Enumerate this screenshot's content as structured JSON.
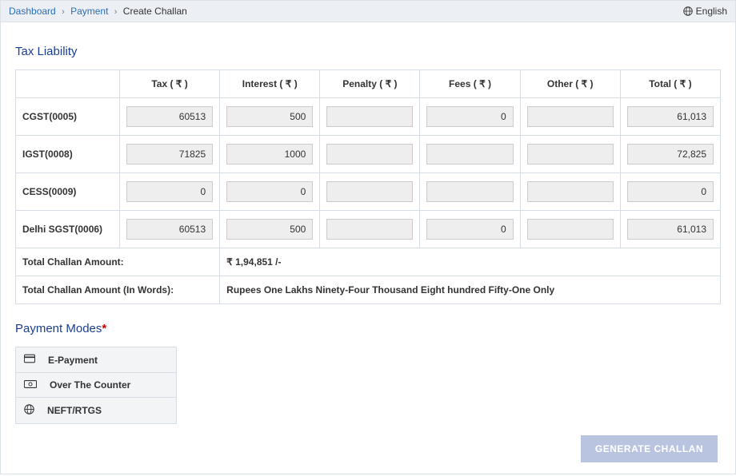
{
  "breadcrumb": {
    "dashboard": "Dashboard",
    "payment": "Payment",
    "current": "Create Challan",
    "sep": "›"
  },
  "language_label": "English",
  "section_liability": "Tax Liability",
  "rupee": "₹",
  "columns": {
    "tax": "Tax ( ₹ )",
    "interest": "Interest ( ₹ )",
    "penalty": "Penalty ( ₹ )",
    "fees": "Fees ( ₹ )",
    "other": "Other ( ₹ )",
    "total": "Total ( ₹ )"
  },
  "rows": [
    {
      "label": "CGST(0005)",
      "tax": "60513",
      "interest": "500",
      "penalty": "",
      "fees": "0",
      "other": "",
      "total": "61,013"
    },
    {
      "label": "IGST(0008)",
      "tax": "71825",
      "interest": "1000",
      "penalty": "",
      "fees": "",
      "other": "",
      "total": "72,825"
    },
    {
      "label": "CESS(0009)",
      "tax": "0",
      "interest": "0",
      "penalty": "",
      "fees": "",
      "other": "",
      "total": "0"
    },
    {
      "label": "Delhi SGST(0006)",
      "tax": "60513",
      "interest": "500",
      "penalty": "",
      "fees": "0",
      "other": "",
      "total": "61,013"
    }
  ],
  "summary": {
    "amount_label": "Total Challan Amount:",
    "amount_value": "₹ 1,94,851 /-",
    "words_label": "Total Challan Amount (In Words):",
    "words_value": "Rupees One Lakhs Ninety-Four Thousand Eight hundred Fifty-One Only"
  },
  "section_payment_modes": "Payment Modes",
  "payment_modes": [
    {
      "key": "epayment",
      "label": "E-Payment",
      "icon": "card-icon"
    },
    {
      "key": "otc",
      "label": "Over The Counter",
      "icon": "cash-icon"
    },
    {
      "key": "neft",
      "label": "NEFT/RTGS",
      "icon": "globe-icon"
    }
  ],
  "generate_button": "GENERATE CHALLAN",
  "chart_data": {
    "type": "table",
    "title": "Tax Liability",
    "columns": [
      "",
      "Tax (₹)",
      "Interest (₹)",
      "Penalty (₹)",
      "Fees (₹)",
      "Other (₹)",
      "Total (₹)"
    ],
    "rows": [
      [
        "CGST(0005)",
        60513,
        500,
        null,
        0,
        null,
        61013
      ],
      [
        "IGST(0008)",
        71825,
        1000,
        null,
        null,
        null,
        72825
      ],
      [
        "CESS(0009)",
        0,
        0,
        null,
        null,
        null,
        0
      ],
      [
        "Delhi SGST(0006)",
        60513,
        500,
        null,
        0,
        null,
        61013
      ]
    ],
    "total_challan_amount": 194851,
    "total_challan_amount_words": "Rupees One Lakhs Ninety-Four Thousand Eight hundred Fifty-One Only"
  }
}
